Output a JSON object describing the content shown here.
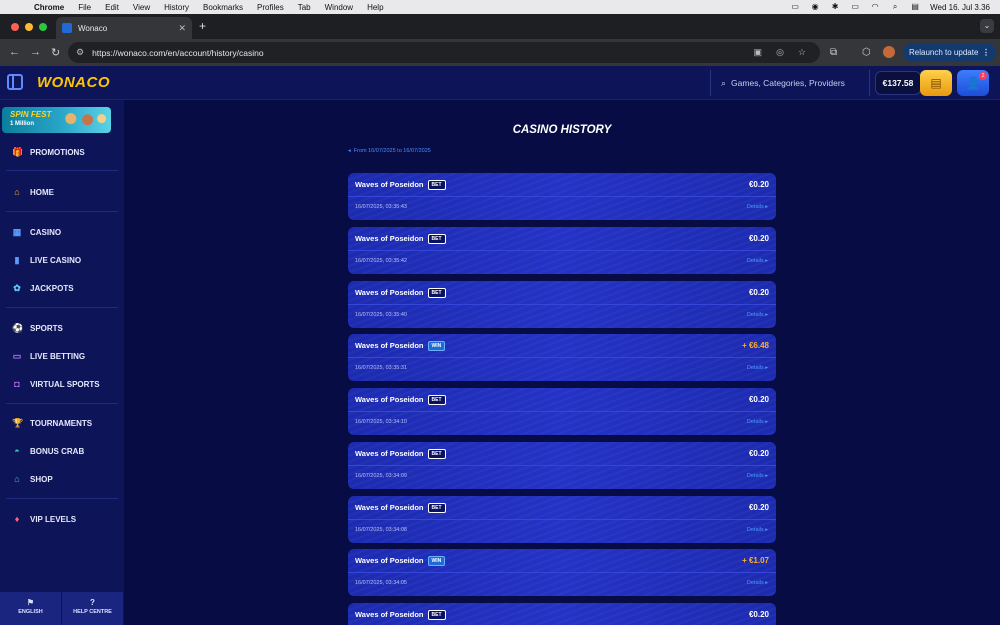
{
  "menubar": {
    "app": "Chrome",
    "items": [
      "File",
      "Edit",
      "View",
      "History",
      "Bookmarks",
      "Profiles",
      "Tab",
      "Window",
      "Help"
    ],
    "clock": "Wed 16. Jul 3.36"
  },
  "browser": {
    "tab_title": "Wonaco",
    "url": "https://wonaco.com/en/account/history/casino",
    "relaunch_label": "Relaunch to update"
  },
  "header": {
    "logo": "WONACO",
    "search_placeholder": "Games, Categories, Providers",
    "balance": "€137.58",
    "notification_count": "2"
  },
  "sidebar": {
    "promo_title": "SPIN FEST",
    "promo_subtitle": "1 Million",
    "items": [
      {
        "label": "PROMOTIONS",
        "icon": "gift-icon"
      },
      {
        "label": "HOME",
        "icon": "home-icon"
      },
      {
        "label": "CASINO",
        "icon": "casino-icon"
      },
      {
        "label": "LIVE CASINO",
        "icon": "live-casino-icon"
      },
      {
        "label": "JACKPOTS",
        "icon": "jackpot-icon"
      },
      {
        "label": "SPORTS",
        "icon": "sports-icon"
      },
      {
        "label": "LIVE BETTING",
        "icon": "live-betting-icon"
      },
      {
        "label": "VIRTUAL SPORTS",
        "icon": "virtual-sports-icon"
      },
      {
        "label": "TOURNAMENTS",
        "icon": "trophy-icon"
      },
      {
        "label": "BONUS CRAB",
        "icon": "crab-icon"
      },
      {
        "label": "SHOP",
        "icon": "shop-icon"
      },
      {
        "label": "VIP LEVELS",
        "icon": "diamond-icon"
      }
    ],
    "language_label": "ENGLISH",
    "help_label": "HELP CENTRE"
  },
  "main": {
    "title": "CASINO HISTORY",
    "date_range": "From 16/07/2025 to 16/07/2025",
    "details_label": "Details",
    "rows": [
      {
        "game": "Waves of Poseidon",
        "type": "BET",
        "amount": "€0.20",
        "time": "16/07/2025, 03:35:43"
      },
      {
        "game": "Waves of Poseidon",
        "type": "BET",
        "amount": "€0.20",
        "time": "16/07/2025, 03:35:42"
      },
      {
        "game": "Waves of Poseidon",
        "type": "BET",
        "amount": "€0.20",
        "time": "16/07/2025, 03:35:40"
      },
      {
        "game": "Waves of Poseidon",
        "type": "WIN",
        "amount": "+ €6.48",
        "time": "16/07/2025, 03:35:31"
      },
      {
        "game": "Waves of Poseidon",
        "type": "BET",
        "amount": "€0.20",
        "time": "16/07/2025, 03:34:10"
      },
      {
        "game": "Waves of Poseidon",
        "type": "BET",
        "amount": "€0.20",
        "time": "16/07/2025, 03:34:09"
      },
      {
        "game": "Waves of Poseidon",
        "type": "BET",
        "amount": "€0.20",
        "time": "16/07/2025, 03:34:08"
      },
      {
        "game": "Waves of Poseidon",
        "type": "WIN",
        "amount": "+ €1.07",
        "time": "16/07/2025, 03:34:05"
      },
      {
        "game": "Waves of Poseidon",
        "type": "BET",
        "amount": "€0.20",
        "time": ""
      }
    ]
  },
  "colors": {
    "brand_yellow": "#ffc400",
    "win_amount": "#ffb02e",
    "link_blue": "#4d9bff"
  }
}
